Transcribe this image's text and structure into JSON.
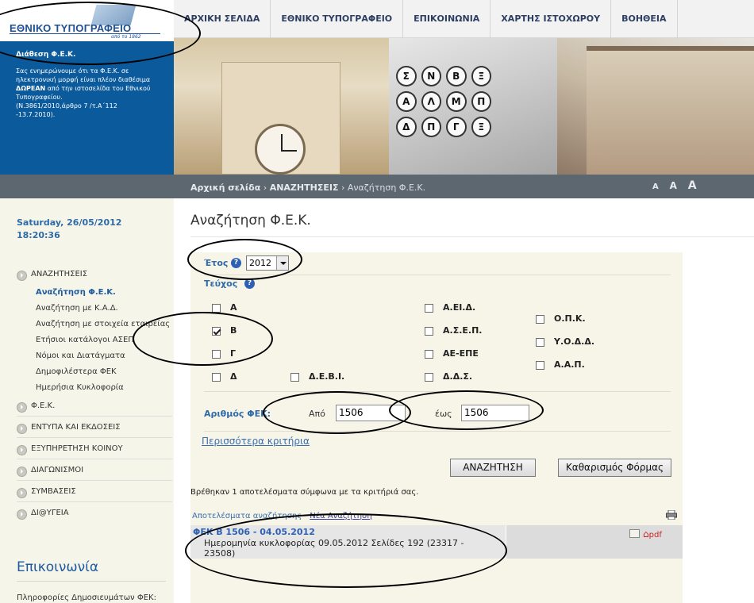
{
  "logo": {
    "text": "ΕΘΝΙΚΟ ΤΥΠΟΓΡΑΦΕΙΟ",
    "sub": "από το 1862"
  },
  "topnav": {
    "items": [
      "ΑΡΧΙΚΗ ΣΕΛΙΔΑ",
      "ΕΘΝΙΚΟ ΤΥΠΟΓΡΑΦΕΙΟ",
      "ΕΠΙΚΟΙΝΩΝΙΑ",
      "ΧΑΡΤΗΣ ΙΣΤΟΧΩΡΟΥ",
      "ΒΟΗΘΕΙΑ"
    ]
  },
  "notice": {
    "title": "Διάθεση Φ.Ε.Κ.",
    "text1": "Σας ενημερώνουμε ότι τα Φ.Ε.Κ. σε ηλεκτρονική μορφή είναι πλέον διαθέσιμα",
    "bold": "ΔΩΡΕΑΝ",
    "text2": "από την ιστοσελίδα του Εθνικού Τυπογραφείου.",
    "text3": "(Ν.3861/2010,άρθρο 7 /τ.Α΄112 -13.7.2010)."
  },
  "banner": {
    "keys": [
      "Σ",
      "Ν",
      "Β",
      "Ξ",
      "Α",
      "Λ",
      "Μ",
      "Π",
      "Δ",
      "Π",
      "Γ",
      "Ξ"
    ]
  },
  "breadcrumb": {
    "home": "Αρχική σελίδα",
    "sep": "›",
    "section": "ΑΝΑΖΗΤΗΣΕΙΣ",
    "current": "Αναζήτηση Φ.Ε.Κ."
  },
  "font_sizes": [
    "A",
    "A",
    "A"
  ],
  "sidebar": {
    "date": "Saturday, 26/05/2012",
    "time": "18:20:36",
    "menu": [
      {
        "label": "ΑΝΑΖΗΤΗΣΕΙΣ",
        "sub": [
          "Αναζήτηση Φ.Ε.Κ.",
          "Αναζήτηση με Κ.Α.Δ.",
          "Αναζήτηση με στοιχεία εταιρείας",
          "Ετήσιοι κατάλογοι ΑΣΕΠ",
          "Νόμοι και Διατάγματα",
          "Δημοφιλέστερα ΦΕΚ",
          "Ημερήσια Κυκλοφορία"
        ]
      },
      {
        "label": "Φ.Ε.Κ."
      },
      {
        "label": "ΕΝΤΥΠΑ ΚΑΙ ΕΚΔΟΣΕΙΣ"
      },
      {
        "label": "ΕΞΥΠΗΡΕΤΗΣΗ ΚΟΙΝΟΥ"
      },
      {
        "label": "ΔΙΑΓΩΝΙΣΜΟΙ"
      },
      {
        "label": "ΣΥΜΒΑΣΕΙΣ"
      },
      {
        "label": "ΔΙ@ΥΓΕΙΑ"
      }
    ],
    "contact_title": "Επικοινωνία",
    "contact_info": "Πληροφορίες Δημοσιευμάτων ΦΕΚ:"
  },
  "main": {
    "title": "Αναζήτηση Φ.Ε.Κ.",
    "year_label": "Έτος",
    "year_value": "2012",
    "issue_label": "Τεύχος",
    "issues": [
      {
        "label": "Α",
        "checked": false
      },
      {
        "label": "Β",
        "checked": true
      },
      {
        "label": "Γ",
        "checked": false
      },
      {
        "label": "Δ",
        "checked": false
      },
      {
        "label": "Δ.Ε.Β.Ι.",
        "checked": false
      },
      {
        "label": "Α.ΕΙ.Δ.",
        "checked": false
      },
      {
        "label": "Α.Σ.Ε.Π.",
        "checked": false
      },
      {
        "label": "ΑΕ-ΕΠΕ",
        "checked": false
      },
      {
        "label": "Δ.Δ.Σ.",
        "checked": false
      },
      {
        "label": "Ο.Π.Κ.",
        "checked": false
      },
      {
        "label": "Υ.Ο.Δ.Δ.",
        "checked": false
      },
      {
        "label": "Α.Α.Π.",
        "checked": false
      }
    ],
    "number_label": "Αριθμός ΦΕΚ:",
    "from_label": "Από",
    "from_value": "1506",
    "to_label": "έως",
    "to_value": "1506",
    "more_criteria": "Περισσότερα κριτήρια",
    "search_button": "ΑΝΑΖΗΤΗΣΗ",
    "clear_button": "Καθαρισμός Φόρμας",
    "results_msg": "Βρέθηκαν 1 αποτελέσματα σύμφωνα με τα κριτήριά σας.",
    "results_link": "Αποτελέσματα αναζήτησης",
    "results_sep": " - ",
    "new_search": "Νέα Αναζήτηση",
    "result": {
      "title": "ΦΕΚ Β 1506 - 04.05.2012",
      "desc": "Ημερομηνία κυκλοφορίας 09.05.2012 Σελίδες 192 (23317 - 23508)",
      "pdf": "pdf"
    }
  }
}
